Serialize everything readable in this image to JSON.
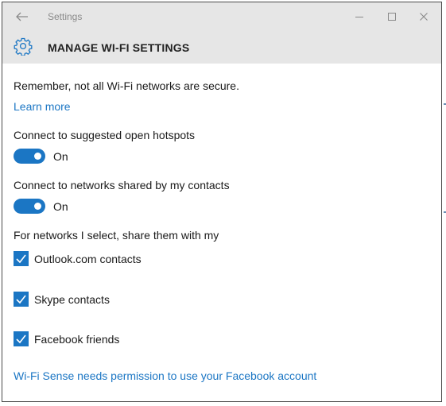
{
  "window": {
    "title": "Settings",
    "back_icon": "back-arrow-icon",
    "minimize_icon": "minimize-icon",
    "maximize_icon": "maximize-icon",
    "close_icon": "close-icon"
  },
  "header": {
    "icon": "gear-icon",
    "title": "MANAGE WI-FI SETTINGS"
  },
  "main": {
    "notice": "Remember, not all Wi-Fi networks are secure.",
    "learn_more": "Learn more",
    "hotspots": {
      "label": "Connect to suggested open hotspots",
      "state": "On"
    },
    "contacts_networks": {
      "label": "Connect to networks shared by my contacts",
      "state": "On"
    },
    "share_heading": "For networks I select, share them with my",
    "share_options": [
      {
        "label": "Outlook.com contacts",
        "checked": true
      },
      {
        "label": "Skype contacts",
        "checked": true
      },
      {
        "label": "Facebook friends",
        "checked": true
      }
    ],
    "facebook_permission": "Wi-Fi Sense needs permission to use your Facebook account"
  },
  "colors": {
    "accent": "#1b76c4",
    "titlebar": "#e6e6e6",
    "text": "#1a1a1a"
  }
}
